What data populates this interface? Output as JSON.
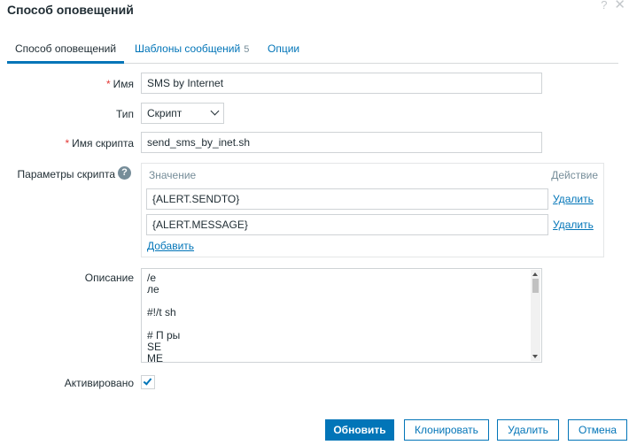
{
  "dialog": {
    "title": "Способ оповещений",
    "help_glyph": "?",
    "close_glyph": "✕"
  },
  "tabs": [
    {
      "label": "Способ оповещений",
      "active": true
    },
    {
      "label": "Шаблоны сообщений",
      "count": "5"
    },
    {
      "label": "Опции"
    }
  ],
  "form": {
    "required_mark": "*",
    "name": {
      "label": "Имя",
      "value": "SMS by Internet"
    },
    "type": {
      "label": "Тип",
      "value": "Скрипт"
    },
    "script_name": {
      "label": "Имя скрипта",
      "value": "send_sms_by_inet.sh"
    },
    "script_params": {
      "label": "Параметры скрипта",
      "help_glyph": "?",
      "header_value": "Значение",
      "header_action": "Действие",
      "rows": [
        {
          "value": "{ALERT.SENDTO}",
          "action": "Удалить"
        },
        {
          "value": "{ALERT.MESSAGE}",
          "action": "Удалить"
        }
      ],
      "add_label": "Добавить"
    },
    "description": {
      "label": "Описание",
      "lines": [
        "/e",
        "ле",
        "",
        "#!/t         sh",
        "",
        "# П         ры",
        "SE",
        "ME"
      ]
    },
    "enabled": {
      "label": "Активировано",
      "checked": true
    }
  },
  "buttons": {
    "update": "Обновить",
    "clone": "Клонировать",
    "delete": "Удалить",
    "cancel": "Отмена"
  },
  "colors": {
    "accent": "#0275b8",
    "required": "#e33734",
    "muted": "#768d99"
  }
}
